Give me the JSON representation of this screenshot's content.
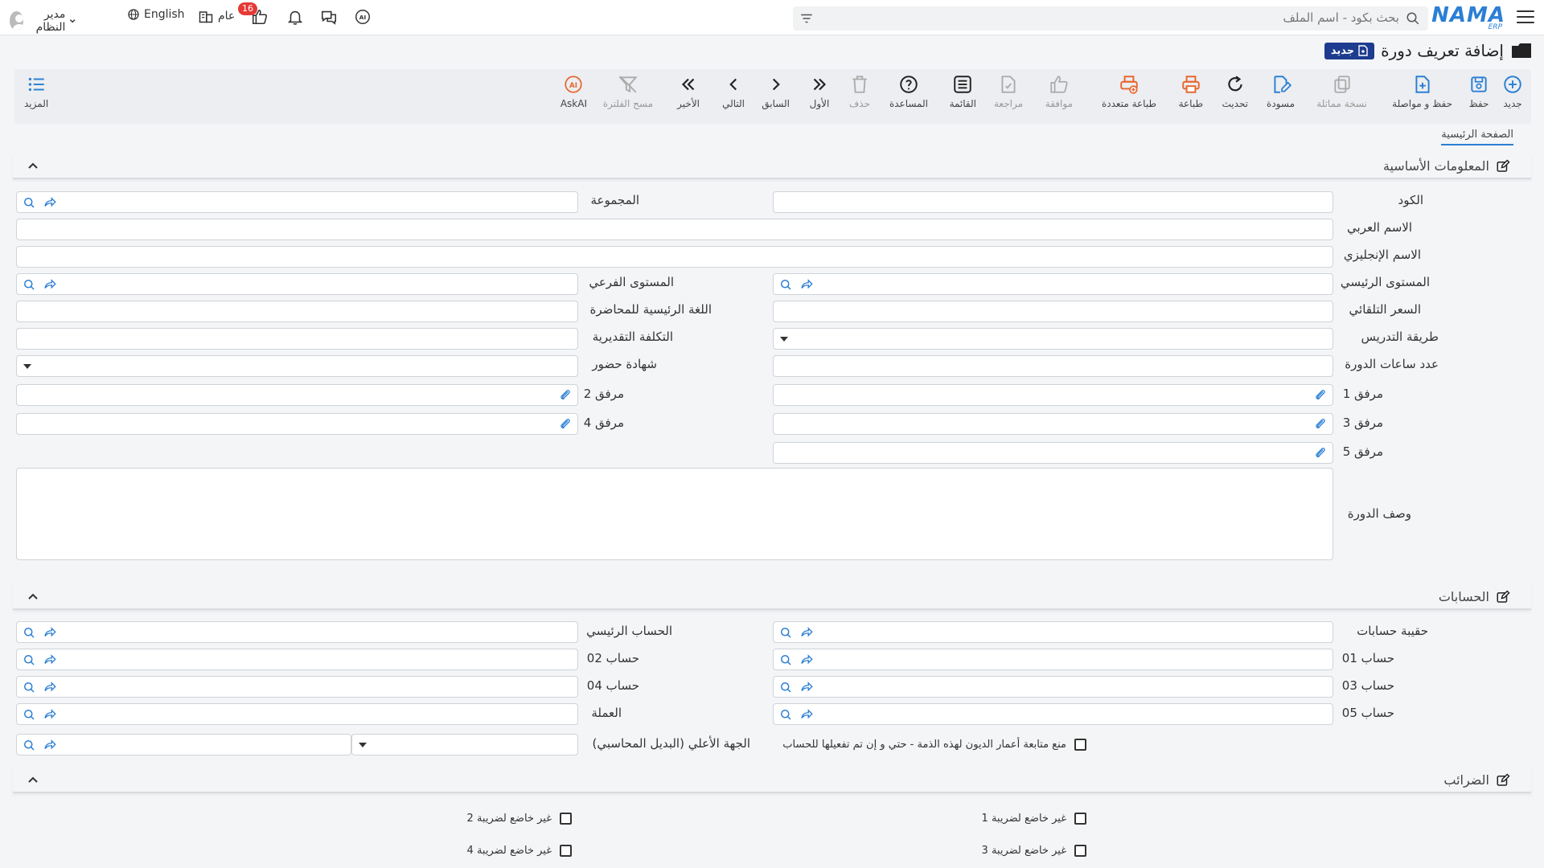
{
  "topbar": {
    "logo": "NAMA",
    "logo_sub": "ERP",
    "search_placeholder": "بحث بكود - اسم الملف",
    "notif_count": "16",
    "branch": "عام",
    "language": "English",
    "user": "مدير النظام"
  },
  "page": {
    "title": "إضافة تعريف دورة",
    "status_badge": "جديد",
    "tab": "الصفحة الرئيسية"
  },
  "toolbar": {
    "new": "جديد",
    "save": "حفظ",
    "save_continue": "حفظ و مواصلة",
    "copy": "نسخة مماثلة",
    "draft": "مسودة",
    "refresh": "تحديث",
    "print": "طباعة",
    "multi_print": "طباعة متعددة",
    "approve": "موافقة",
    "review": "مراجعة",
    "list": "القائمة",
    "help": "المساعدة",
    "delete": "حذف",
    "first": "الأول",
    "previous": "السابق",
    "next": "التالي",
    "last": "الأخير",
    "clear_filter": "مسح الفلترة",
    "askai": "AskAI",
    "more": "المزيد"
  },
  "basic_info": {
    "title": "المعلومات الأساسية",
    "code": "الكود",
    "group": "المجموعة",
    "arabic_name": "الاسم العربي",
    "english_name": "الاسم الإنجليزي",
    "main_level": "المستوى الرئيسي",
    "sub_level": "المستوى الفرعي",
    "auto_price": "السعر التلقائي",
    "main_language": "اللغة الرئيسية للمحاضرة",
    "teaching_method": "طريقة التدريس",
    "estimated_cost": "التكلفة التقديرية",
    "course_hours": "عدد ساعات الدورة",
    "attendance_cert": "شهادة حضور",
    "attach1": "مرفق 1",
    "attach2": "مرفق 2",
    "attach3": "مرفق 3",
    "attach4": "مرفق 4",
    "attach5": "مرفق 5",
    "description": "وصف الدورة"
  },
  "accounts": {
    "title": "الحسابات",
    "portfolio": "حقيبة حسابات",
    "main_account": "الحساب الرئيسي",
    "acc01": "حساب 01",
    "acc02": "حساب 02",
    "acc03": "حساب 03",
    "acc04": "حساب 04",
    "acc05": "حساب 05",
    "currency": "العملة",
    "prevent_aging": "منع متابعة أعمار الديون لهذه الذمة - حتي و إن تم تفعيلها للحساب",
    "higher_entity": "الجهة الأعلي (البديل المحاسبي)"
  },
  "taxes": {
    "title": "الضرائب",
    "tax1": "غير خاضع لضريبة 1",
    "tax2": "غير خاضع لضريبة 2",
    "tax3": "غير خاضع لضريبة 3",
    "tax4": "غير خاضع لضريبة 4"
  },
  "colors": {
    "accent": "#2b7fd4",
    "badge": "#1d3c8f",
    "print": "#e8652d"
  }
}
